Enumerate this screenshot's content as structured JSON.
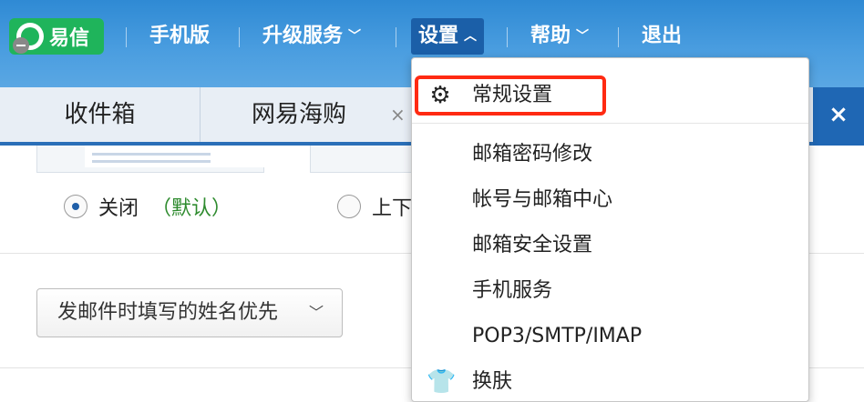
{
  "topnav": {
    "yixin_label": "易信",
    "mobile_label": "手机版",
    "upgrade_label": "升级服务",
    "settings_label": "设置",
    "help_label": "帮助",
    "logout_label": "退出",
    "chevron_down": "﹀",
    "chevron_up": "︿"
  },
  "tabs": {
    "inbox": "收件箱",
    "shop": "网易海购",
    "close_glyph": "×",
    "right_close_glyph": "×"
  },
  "content": {
    "radio_off_label": "关闭",
    "radio_off_default": "（默认）",
    "radio_updown_label": "上下",
    "sender_select_value": "发邮件时填写的姓名优先",
    "select_chevron": "﹀"
  },
  "dropdown": {
    "items": [
      {
        "label": "常规设置",
        "icon": "gear-icon",
        "glyph": "⚙"
      },
      {
        "label": "邮箱密码修改"
      },
      {
        "label": "帐号与邮箱中心"
      },
      {
        "label": "邮箱安全设置"
      },
      {
        "label": "手机服务"
      },
      {
        "label": "POP3/SMTP/IMAP"
      },
      {
        "label": "换肤",
        "icon": "tshirt-icon",
        "glyph": "👕"
      }
    ]
  },
  "colors": {
    "topbar": "#3a93da",
    "active_nav": "#1b5fa8",
    "highlight": "#ff2a12",
    "yixin_green": "#1fb45b"
  }
}
